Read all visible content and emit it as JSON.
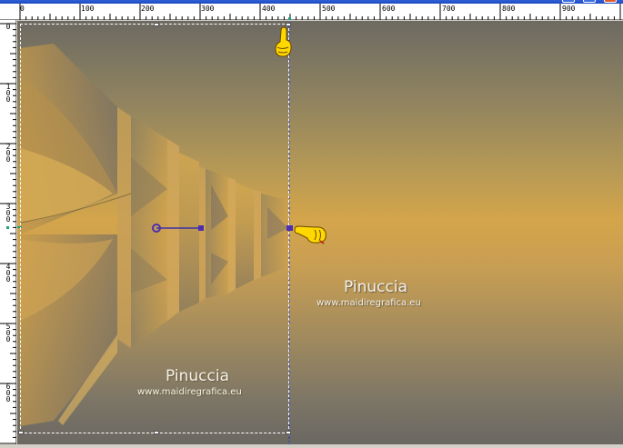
{
  "ruler": {
    "horizontal_labels": [
      "0",
      "100",
      "200",
      "300",
      "400",
      "500",
      "600",
      "700",
      "800",
      "900"
    ],
    "vertical_labels": [
      "0",
      "100",
      "200",
      "300",
      "400",
      "500",
      "600"
    ]
  },
  "watermark_canvas": {
    "name": "Pinuccia",
    "url": "www.maidiregrafica.eu"
  },
  "watermark_selection": {
    "name": "Pinuccia",
    "url": "www.maidiregrafica.eu"
  },
  "icons": {
    "hand_top": "pointing-hand-icon",
    "hand_middle": "pointing-hand-icon",
    "pick_tool_handle": "rotation-handle-icon"
  },
  "colors": {
    "canvas_light": "#d4a54a",
    "canvas_dark": "#6b6862",
    "guide_line": "#3030a8",
    "handle": "#4a2fb0"
  }
}
